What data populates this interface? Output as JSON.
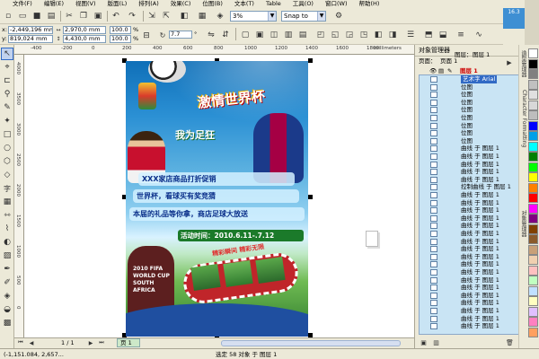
{
  "menu": [
    "文件(F)",
    "编辑(E)",
    "视图(V)",
    "版面(L)",
    "排列(A)",
    "效果(C)",
    "位图(B)",
    "文本(T)",
    "Table",
    "工具(O)",
    "窗口(W)",
    "帮助(H)"
  ],
  "toolbar": {
    "zoom_value": "3%",
    "snap_label": "Snap to"
  },
  "property_bar": {
    "x_value": "-2,449,196 mm",
    "y_value": "819,024 mm",
    "width_value": "2,970,0 mm",
    "height_value": "4,430,0 mm",
    "scale_w": "100.0",
    "scale_h": "100.0",
    "percent_w": "%",
    "percent_h": "%",
    "rotation_value": "7.7",
    "rotation_unit": "°",
    "x_label": "x:",
    "y_label": "y:"
  },
  "corner_badge": "16.3",
  "ruler": {
    "units": "millimeters",
    "ticks": [
      "-400",
      "-200",
      "0",
      "200",
      "400",
      "600",
      "800",
      "1000",
      "1200",
      "1400",
      "1600",
      "1800"
    ],
    "left_ticks": [
      "4000",
      "3500",
      "3000",
      "2500",
      "2000",
      "1500",
      "1000",
      "500",
      "0"
    ]
  },
  "poster": {
    "title_logo": "激情世界杯",
    "subtitle_logo": "我为足狂",
    "line1": "XXX家店商品打折促销",
    "line2": "世界杯，看球买有奖竞猜",
    "line3": "本届的礼品等你拿，商店足球大放送",
    "date_line": "活动时间：2010.6.11-.7.12",
    "worldcup_badge": "2010 FIFA WORLD CUP SOUTH AFRICA",
    "film_caption": "精彩瞬间 精彩无限"
  },
  "object_manager": {
    "title": "对象管理器",
    "page_label": "页面：",
    "page_value": "页面 1",
    "layer_label": "图层：",
    "layer_value": "图层 1",
    "layer_name": "图层 1",
    "rows": [
      "艺术字 Arial",
      "位图",
      "位图",
      "位图",
      "位图",
      "位图",
      "位图",
      "位图",
      "位图",
      "曲线 于 图层 1",
      "曲线 于 图层 1",
      "曲线 于 图层 1",
      "曲线 于 图层 1",
      "曲线 于 图层 1",
      "控制曲线 于 图层 1",
      "曲线 于 图层 1",
      "曲线 于 图层 1",
      "曲线 于 图层 1",
      "曲线 于 图层 1",
      "曲线 于 图层 1",
      "曲线 于 图层 1",
      "曲线 于 图层 1",
      "曲线 于 图层 1",
      "曲线 于 图层 1",
      "曲线 于 图层 1",
      "曲线 于 图层 1",
      "曲线 于 图层 1",
      "曲线 于 图层 1",
      "曲线 于 图层 1",
      "曲线 于 图层 1",
      "曲线 于 图层 1",
      "曲线 于 图层 1",
      "曲线 于 图层 1"
    ]
  },
  "side_tabs": [
    "造型管理器",
    "Character Formatting",
    "对象管理器"
  ],
  "palette": [
    "#ffffff",
    "#000000",
    "#808080",
    "#c0c0c0",
    "#e0e0e0",
    "#d8d8d8",
    "#bdbdbd",
    "#0000ff",
    "#00a0e8",
    "#00ffff",
    "#008000",
    "#00ff00",
    "#ffff00",
    "#ff8000",
    "#ff0000",
    "#ff00ff",
    "#800080",
    "#804000",
    "#8a5a2b",
    "#c8a078",
    "#f0d0b0",
    "#ffc0c0",
    "#c0ffc0",
    "#c0e0ff",
    "#ffffc0",
    "#e0c0ff",
    "#ff80c0",
    "#ffa060"
  ],
  "pagebar": {
    "page_counter": "1 / 1",
    "page_tab": "页 1"
  },
  "status": {
    "coords": "(-1,151.084, 2,657...",
    "selection": "选定 58 对象 于 图层 1"
  }
}
